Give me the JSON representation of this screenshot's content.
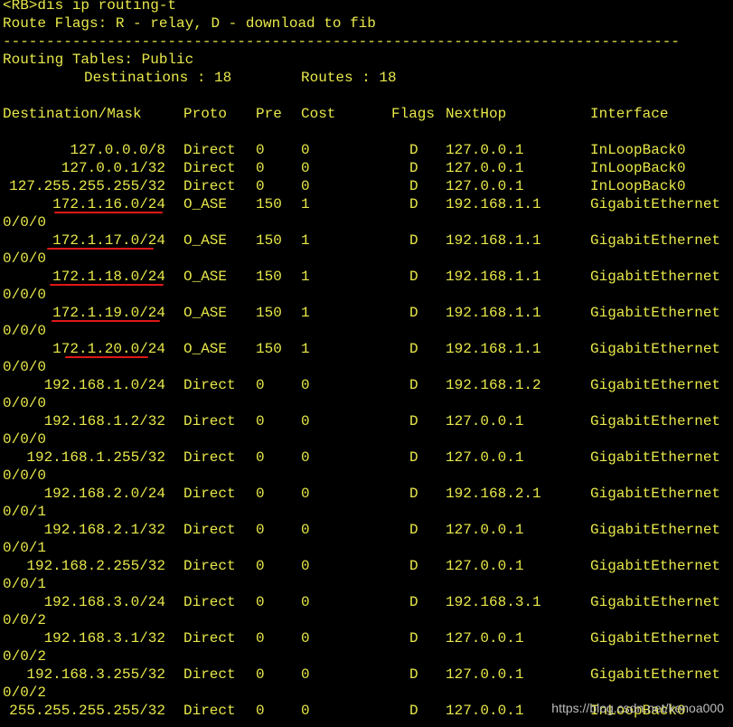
{
  "terminal": {
    "prompt_line": "<RB>dis ip routing-t",
    "flags_line": "Route Flags: R - relay, D - download to fib",
    "separator": "------------------------------------------------------------------------------",
    "tables_line": "Routing Tables: Public",
    "destinations_label": "Destinations : 18",
    "routes_label": "Routes : 18",
    "headers": {
      "destination": "Destination/Mask",
      "proto": "Proto",
      "pre": "Pre",
      "cost": "Cost",
      "flags": "Flags",
      "nexthop": "NextHop",
      "interface": "Interface"
    },
    "routes": [
      {
        "dest": "127.0.0.0/8",
        "proto": "Direct",
        "pre": "0",
        "cost": "0",
        "flags": "D",
        "nexthop": "127.0.0.1",
        "iface": "InLoopBack0",
        "iface_cont": "",
        "highlight": false
      },
      {
        "dest": "127.0.0.1/32",
        "proto": "Direct",
        "pre": "0",
        "cost": "0",
        "flags": "D",
        "nexthop": "127.0.0.1",
        "iface": "InLoopBack0",
        "iface_cont": "",
        "highlight": false
      },
      {
        "dest": "127.255.255.255/32",
        "proto": "Direct",
        "pre": "0",
        "cost": "0",
        "flags": "D",
        "nexthop": "127.0.0.1",
        "iface": "InLoopBack0",
        "iface_cont": "",
        "highlight": false
      },
      {
        "dest": "172.1.16.0/24",
        "proto": "O_ASE",
        "pre": "150",
        "cost": "1",
        "flags": "D",
        "nexthop": "192.168.1.1",
        "iface": "GigabitEthernet",
        "iface_cont": "0/0/0",
        "highlight": true
      },
      {
        "dest": "172.1.17.0/24",
        "proto": "O_ASE",
        "pre": "150",
        "cost": "1",
        "flags": "D",
        "nexthop": "192.168.1.1",
        "iface": "GigabitEthernet",
        "iface_cont": "0/0/0",
        "highlight": true
      },
      {
        "dest": "172.1.18.0/24",
        "proto": "O_ASE",
        "pre": "150",
        "cost": "1",
        "flags": "D",
        "nexthop": "192.168.1.1",
        "iface": "GigabitEthernet",
        "iface_cont": "0/0/0",
        "highlight": true
      },
      {
        "dest": "172.1.19.0/24",
        "proto": "O_ASE",
        "pre": "150",
        "cost": "1",
        "flags": "D",
        "nexthop": "192.168.1.1",
        "iface": "GigabitEthernet",
        "iface_cont": "0/0/0",
        "highlight": true
      },
      {
        "dest": "172.1.20.0/24",
        "proto": "O_ASE",
        "pre": "150",
        "cost": "1",
        "flags": "D",
        "nexthop": "192.168.1.1",
        "iface": "GigabitEthernet",
        "iface_cont": "0/0/0",
        "highlight": true
      },
      {
        "dest": "192.168.1.0/24",
        "proto": "Direct",
        "pre": "0",
        "cost": "0",
        "flags": "D",
        "nexthop": "192.168.1.2",
        "iface": "GigabitEthernet",
        "iface_cont": "0/0/0",
        "highlight": false
      },
      {
        "dest": "192.168.1.2/32",
        "proto": "Direct",
        "pre": "0",
        "cost": "0",
        "flags": "D",
        "nexthop": "127.0.0.1",
        "iface": "GigabitEthernet",
        "iface_cont": "0/0/0",
        "highlight": false
      },
      {
        "dest": "192.168.1.255/32",
        "proto": "Direct",
        "pre": "0",
        "cost": "0",
        "flags": "D",
        "nexthop": "127.0.0.1",
        "iface": "GigabitEthernet",
        "iface_cont": "0/0/0",
        "highlight": false
      },
      {
        "dest": "192.168.2.0/24",
        "proto": "Direct",
        "pre": "0",
        "cost": "0",
        "flags": "D",
        "nexthop": "192.168.2.1",
        "iface": "GigabitEthernet",
        "iface_cont": "0/0/1",
        "highlight": false
      },
      {
        "dest": "192.168.2.1/32",
        "proto": "Direct",
        "pre": "0",
        "cost": "0",
        "flags": "D",
        "nexthop": "127.0.0.1",
        "iface": "GigabitEthernet",
        "iface_cont": "0/0/1",
        "highlight": false
      },
      {
        "dest": "192.168.2.255/32",
        "proto": "Direct",
        "pre": "0",
        "cost": "0",
        "flags": "D",
        "nexthop": "127.0.0.1",
        "iface": "GigabitEthernet",
        "iface_cont": "0/0/1",
        "highlight": false
      },
      {
        "dest": "192.168.3.0/24",
        "proto": "Direct",
        "pre": "0",
        "cost": "0",
        "flags": "D",
        "nexthop": "192.168.3.1",
        "iface": "GigabitEthernet",
        "iface_cont": "0/0/2",
        "highlight": false
      },
      {
        "dest": "192.168.3.1/32",
        "proto": "Direct",
        "pre": "0",
        "cost": "0",
        "flags": "D",
        "nexthop": "127.0.0.1",
        "iface": "GigabitEthernet",
        "iface_cont": "0/0/2",
        "highlight": false
      },
      {
        "dest": "192.168.3.255/32",
        "proto": "Direct",
        "pre": "0",
        "cost": "0",
        "flags": "D",
        "nexthop": "127.0.0.1",
        "iface": "GigabitEthernet",
        "iface_cont": "0/0/2",
        "highlight": false
      },
      {
        "dest": "255.255.255.255/32",
        "proto": "Direct",
        "pre": "0",
        "cost": "0",
        "flags": "D",
        "nexthop": "127.0.0.1",
        "iface": "InLoopBack0",
        "iface_cont": "",
        "highlight": false
      }
    ]
  },
  "watermark": "https://blog.csdn.net/kenoa000",
  "colors": {
    "background": "#000000",
    "text": "#e8e84a",
    "highlight_underline": "#e01818",
    "watermark": "#bdbdbd"
  }
}
